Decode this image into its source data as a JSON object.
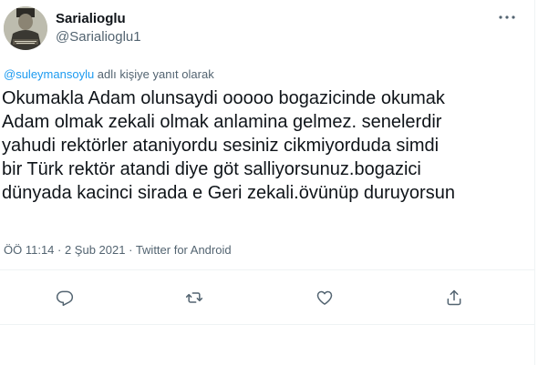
{
  "tweet": {
    "display_name": "Sarialioglu",
    "handle": "@Sarialioglu1",
    "reply_to": {
      "mention": "@suleymansoylu",
      "suffix": " adlı kişiye yanıt olarak"
    },
    "text": "Okumakla Adam olunsaydi ooooo bogazicinde okumak\nAdam olmak zekali olmak anlamina gelmez. senelerdir\nyahudi rektörler ataniyordu sesiniz cikmiyorduda simdi\nbir Türk rektör atandi diye göt salliyorsunuz.bogazici\ndünyada kacinci sirada e Geri zekali.övünüp duruyorsun",
    "time": "ÖÖ 11:14",
    "separator": " · ",
    "date": "2 Şub 2021",
    "source": "Twitter for Android"
  },
  "icons": {
    "more": "more-horizontal-icon",
    "reply": "reply-icon",
    "retweet": "retweet-icon",
    "like": "like-icon",
    "share": "share-icon"
  },
  "colors": {
    "text": "#0f1419",
    "secondary": "#536471",
    "link": "#1d9bf0",
    "border": "#eff3f4"
  }
}
